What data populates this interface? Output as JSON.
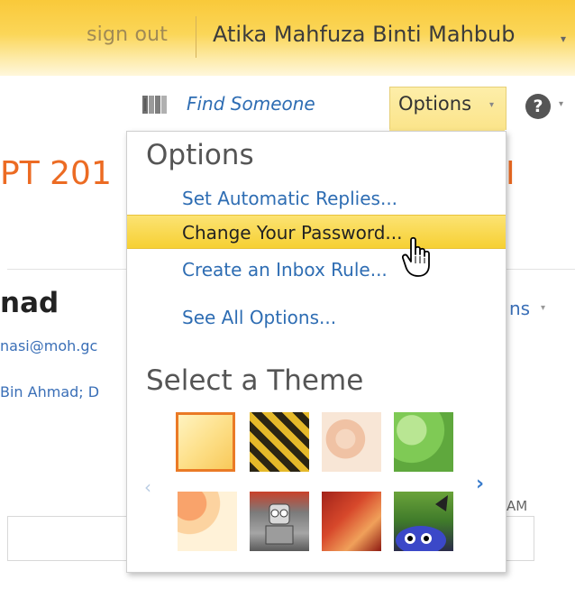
{
  "topbar": {
    "signout_label": "sign out",
    "user_name": "Atika Mahfuza Binti Mahbub"
  },
  "toolbar": {
    "find_label": "Find Someone",
    "options_label": "Options",
    "help_label": "?"
  },
  "background": {
    "title_left": "PT 201",
    "title_right": "I",
    "name": "nad",
    "email": "nasi@moh.gc",
    "to": "Bin Ahmad; D",
    "options_partial": "ns",
    "time_partial": "AM"
  },
  "menu": {
    "heading": "Options",
    "items": [
      {
        "label": "Set Automatic Replies..."
      },
      {
        "label": "Change Your Password..."
      },
      {
        "label": "Create an Inbox Rule..."
      },
      {
        "label": "See All Options..."
      }
    ],
    "theme_heading": "Select a Theme",
    "themes": [
      {
        "name": "orange-gradient",
        "selected": true
      },
      {
        "name": "yellow-black-stripes",
        "selected": false
      },
      {
        "name": "peach-sketch",
        "selected": false
      },
      {
        "name": "green-leaves",
        "selected": false
      },
      {
        "name": "sunset-circles",
        "selected": false
      },
      {
        "name": "robots",
        "selected": false
      },
      {
        "name": "red-autumn-leaves",
        "selected": false
      },
      {
        "name": "blue-monsters",
        "selected": false
      }
    ]
  },
  "colors": {
    "accent_orange": "#ec6b23",
    "link_blue": "#2e6db3",
    "highlight_yellow": "#f6d033"
  }
}
